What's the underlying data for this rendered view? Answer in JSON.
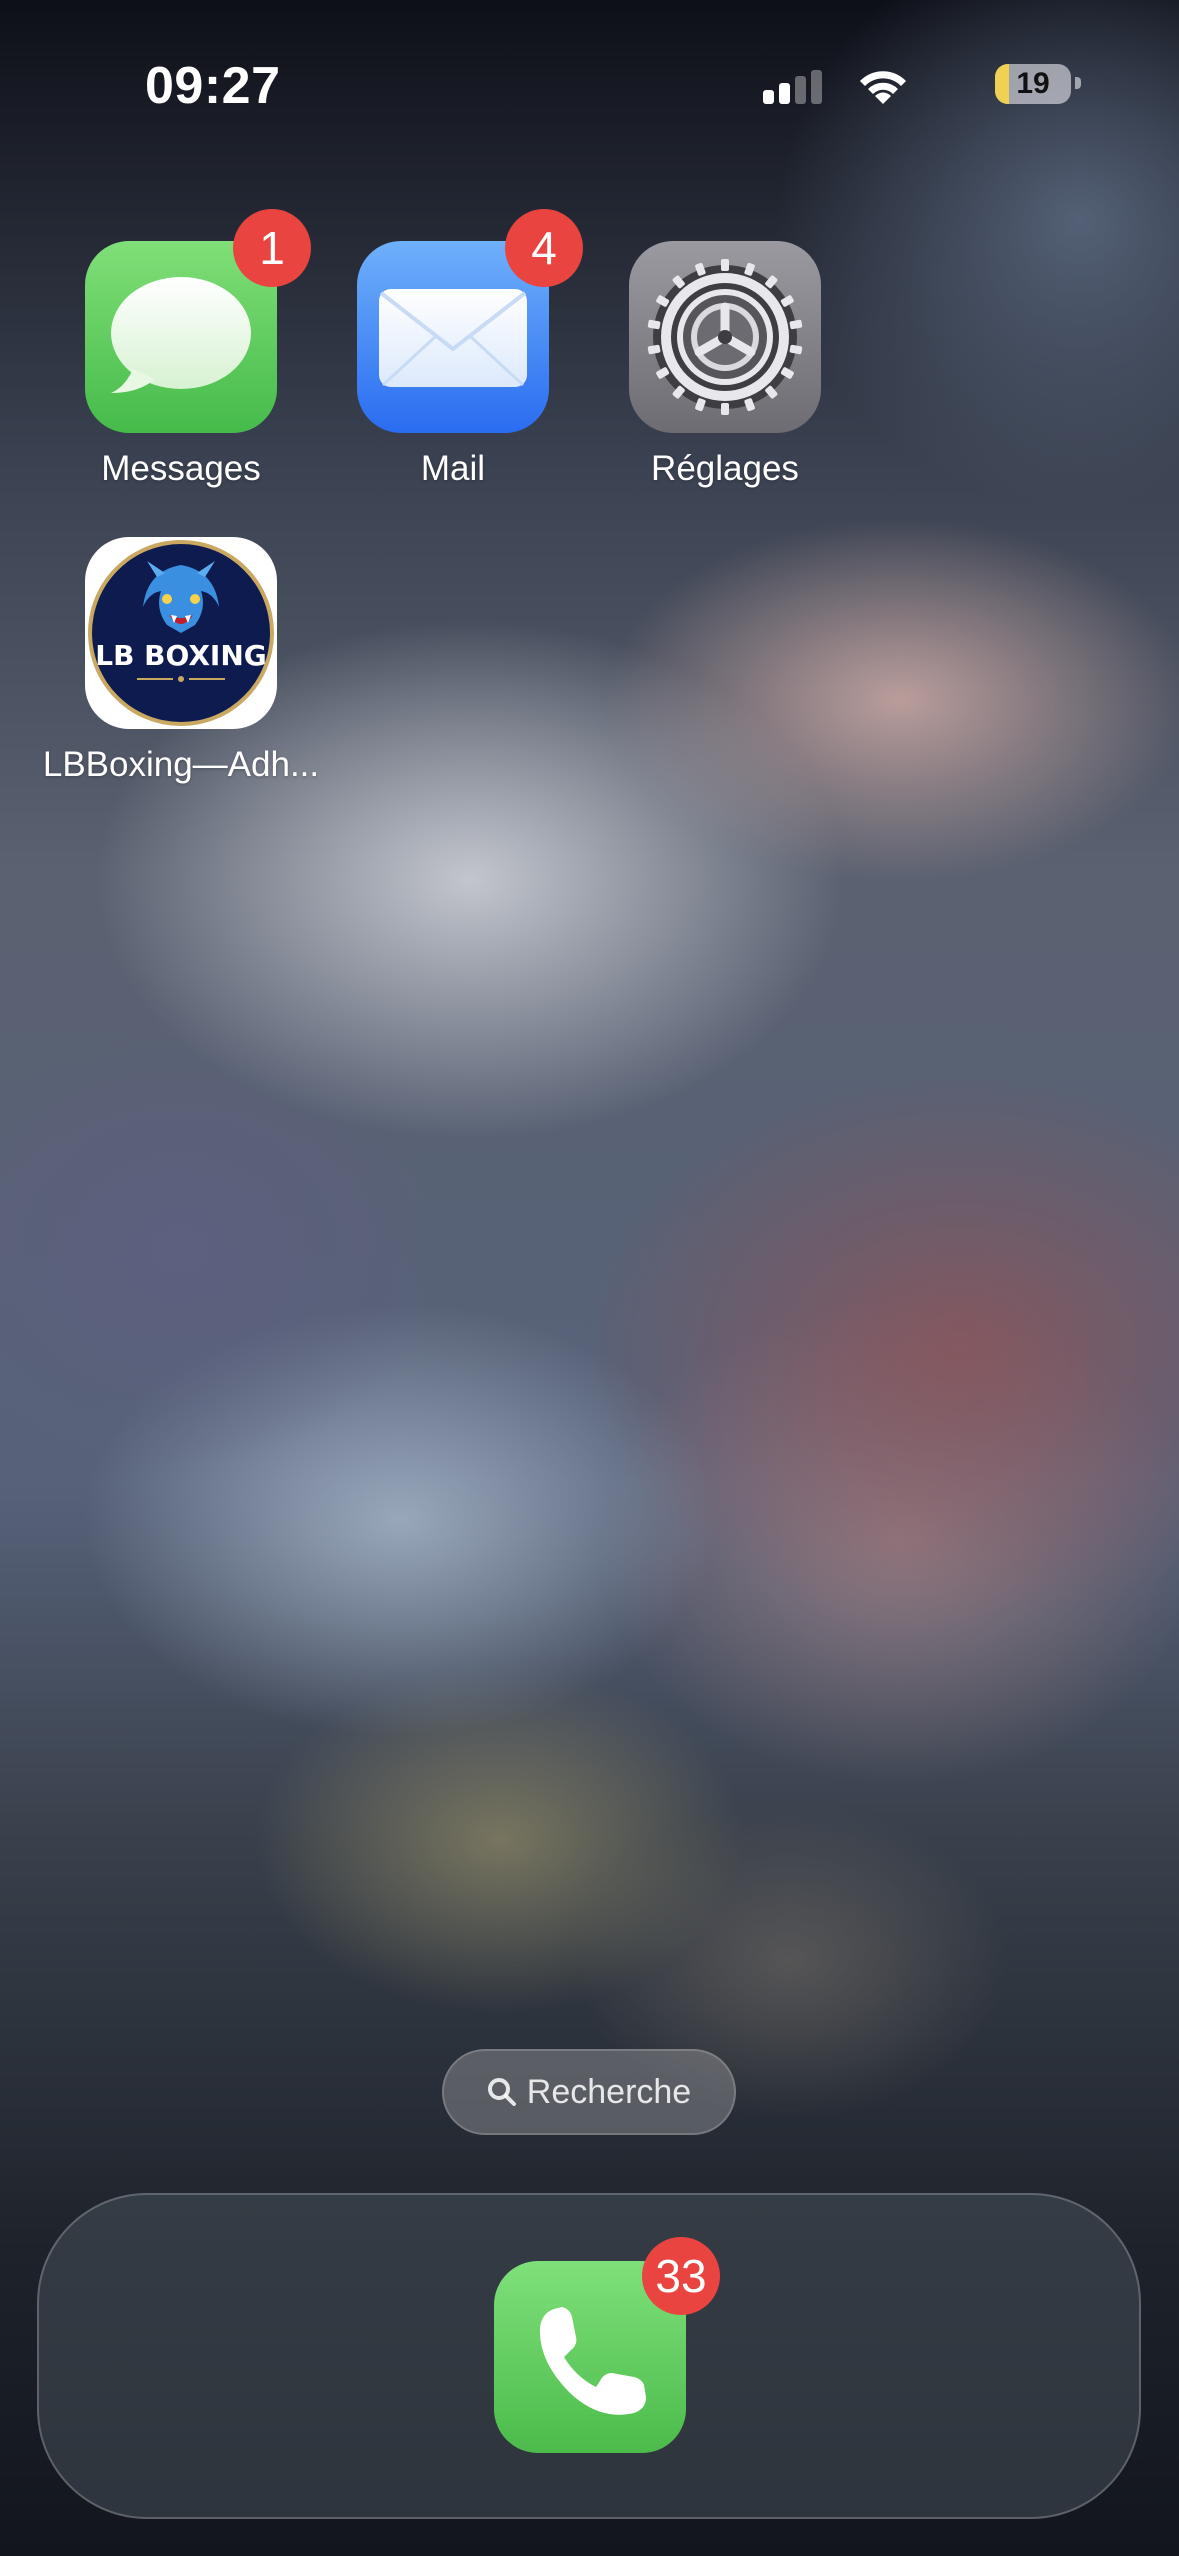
{
  "status_bar": {
    "time": "09:27",
    "signal_bars": 2,
    "battery_percent": "19",
    "battery_color": "#f1d152"
  },
  "apps": [
    {
      "name": "Messages",
      "icon": "messages-icon",
      "badge": "1",
      "color": "#4cc450"
    },
    {
      "name": "Mail",
      "icon": "mail-icon",
      "badge": "4",
      "color": "#2f7cf6"
    },
    {
      "name": "Réglages",
      "icon": "settings-gear-icon",
      "badge": "",
      "color": "#8e8e93"
    },
    {
      "name": "LBBoxing—Adh...",
      "icon": "lb-boxing-logo",
      "badge": "",
      "logo_text": "LB BOXING",
      "color": "#0e1b4f"
    }
  ],
  "search": {
    "label": "Recherche"
  },
  "dock": {
    "apps": [
      {
        "name": "Phone",
        "icon": "phone-icon",
        "badge": "33",
        "color": "#4cc450"
      }
    ]
  },
  "colors": {
    "badge": "#ea4440"
  }
}
